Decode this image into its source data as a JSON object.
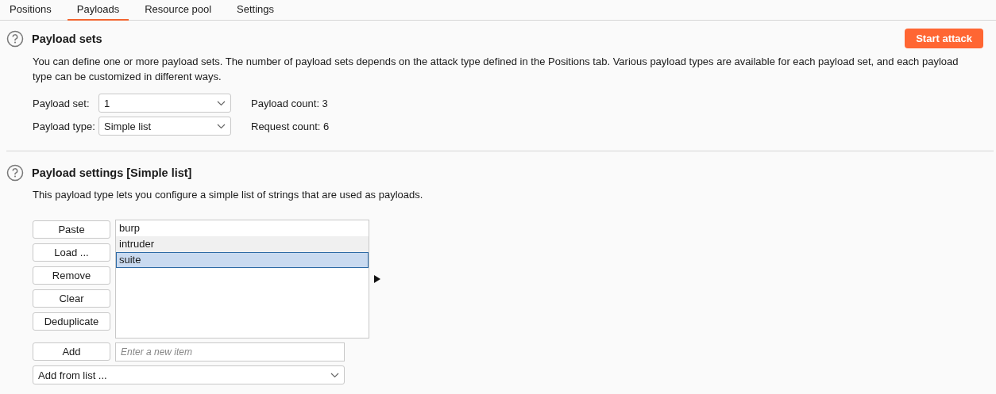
{
  "tabs": [
    {
      "label": "Positions",
      "selected": false
    },
    {
      "label": "Payloads",
      "selected": true
    },
    {
      "label": "Resource pool",
      "selected": false
    },
    {
      "label": "Settings",
      "selected": false
    }
  ],
  "payload_sets": {
    "title": "Payload sets",
    "action": "Start attack",
    "description": "You can define one or more payload sets. The number of payload sets depends on the attack type defined in the Positions tab. Various payload types are available for each payload set, and each payload type can be customized in different ways.",
    "fields": [
      {
        "label": "Payload set:",
        "value": "1",
        "info": "Payload count: 3"
      },
      {
        "label": "Payload type:",
        "value": "Simple list",
        "info": "Request count: 6"
      }
    ]
  },
  "payload_settings": {
    "title": "Payload settings [Simple list]",
    "description": "This payload type lets you configure a simple list of strings that are used as payloads.",
    "buttons": [
      "Paste",
      "Load ...",
      "Remove",
      "Clear",
      "Deduplicate"
    ],
    "items": [
      {
        "label": "burp",
        "selected": false,
        "hovered": false
      },
      {
        "label": "intruder",
        "selected": false,
        "hovered": true
      },
      {
        "label": "suite",
        "selected": true,
        "hovered": false
      }
    ],
    "add_button": "Add",
    "add_placeholder": "Enter a new item",
    "add_from_list": "Add from list ..."
  }
}
